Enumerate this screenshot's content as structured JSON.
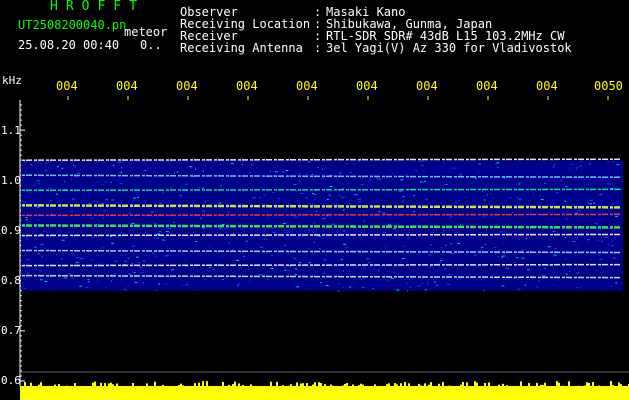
{
  "header": {
    "app_title": "HROFFT",
    "filename": "UT2508200040.pn",
    "mode_label": "meteor",
    "timestamp": "25.08.20 00:40",
    "count": "0.."
  },
  "station_info": [
    {
      "key": "Observer",
      "sep": ":",
      "value": "Masaki Kano"
    },
    {
      "key": "Receiving Location",
      "sep": ":",
      "value": "Shibukawa, Gunma, Japan"
    },
    {
      "key": "Receiver",
      "sep": ":",
      "value": "RTL-SDR SDR# 43dB L15 103.2MHz CW"
    },
    {
      "key": "Receiving Antenna",
      "sep": ":",
      "value": "3el Yagi(V) Az 330 for Vladivostok"
    }
  ],
  "y_axis": {
    "unit": "kHz",
    "ticks": [
      "1.1",
      "1.0",
      "0.9",
      "0.8",
      "0.7",
      "0.6"
    ]
  },
  "x_axis": {
    "ticks": [
      "004",
      "004",
      "004",
      "004",
      "004",
      "004",
      "004",
      "004",
      "004",
      "0050"
    ]
  },
  "colors": {
    "background": "#000000",
    "title_green": "#00ff00",
    "tick_yellow": "#ffff00",
    "text_white": "#ffffff",
    "spectrogram_bg": "#00008b"
  },
  "chart_data": {
    "type": "heatmap",
    "ylabel": "kHz",
    "ylim": [
      0.6,
      1.15
    ],
    "strong_lines_khz": [
      1.04,
      1.01,
      0.98,
      0.95,
      0.93,
      0.91,
      0.89,
      0.86,
      0.83,
      0.81
    ],
    "band_khz": [
      0.78,
      1.04
    ],
    "signal_level": "high"
  }
}
